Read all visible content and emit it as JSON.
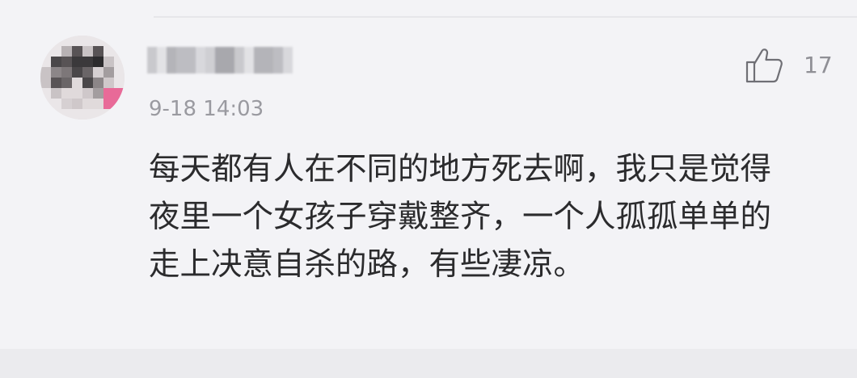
{
  "comment": {
    "timestamp": "9-18 14:03",
    "like_count": "17",
    "lines": [
      "每天都有人在不同的地方死去啊，我只是觉得",
      "夜里一个女孩子穿戴整齐，一个人孤孤单单的",
      "走上决意自杀的路，有些凄凉。"
    ]
  },
  "icons": {
    "like": "thumbs-up-icon"
  },
  "colors": {
    "background": "#f3f3f6",
    "text": "#2b2b2d",
    "muted": "#9a9aa0",
    "avatar_accent": "#e86a98"
  }
}
